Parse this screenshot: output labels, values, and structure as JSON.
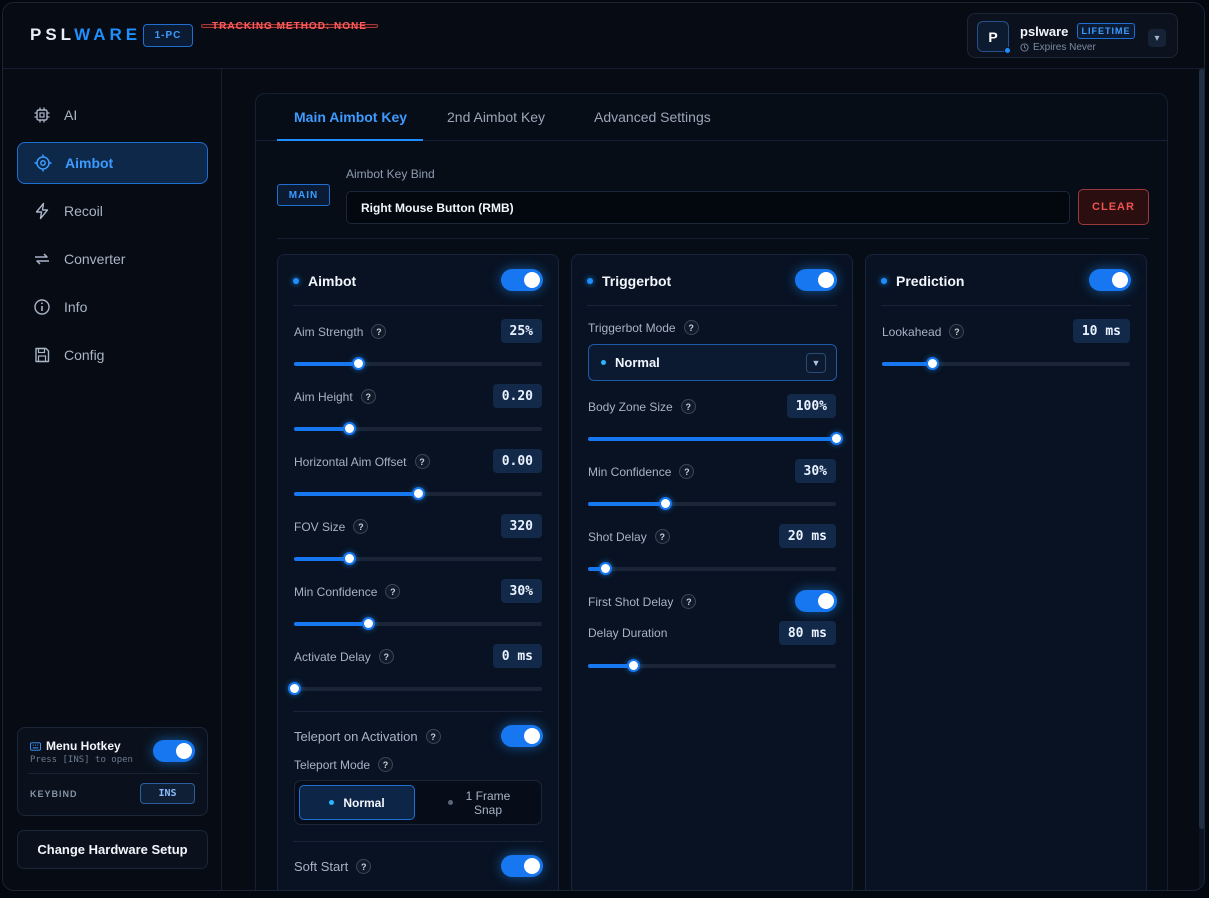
{
  "header": {
    "logo_left": "PSL",
    "logo_right": "WARE",
    "pc_badge": "1-PC",
    "tracking_badge": "TRACKING METHOD: NONE",
    "user": {
      "initial": "P",
      "name": "pslware",
      "plan": "LIFETIME",
      "expires": "Expires Never"
    }
  },
  "sidebar": {
    "items": [
      {
        "label": "AI",
        "icon": "chip-icon"
      },
      {
        "label": "Aimbot",
        "icon": "crosshair-icon",
        "active": true
      },
      {
        "label": "Recoil",
        "icon": "bolt-icon"
      },
      {
        "label": "Converter",
        "icon": "swap-icon"
      },
      {
        "label": "Info",
        "icon": "info-icon"
      },
      {
        "label": "Config",
        "icon": "save-icon"
      }
    ],
    "hotkey": {
      "title": "Menu Hotkey",
      "subtitle": "Press [INS] to open",
      "keybind_label": "KEYBIND",
      "key": "INS",
      "enabled": true
    },
    "hardware_button": "Change Hardware Setup"
  },
  "main": {
    "tabs": [
      "Main Aimbot Key",
      "2nd Aimbot Key",
      "Advanced Settings"
    ],
    "active_tab": 0,
    "main_badge": "MAIN",
    "keybind_label": "Aimbot Key Bind",
    "keybind_value": "Right Mouse Button (RMB)",
    "clear_button": "CLEAR"
  },
  "aimbot": {
    "title": "Aimbot",
    "enabled": true,
    "sliders": [
      {
        "label": "Aim Strength",
        "value": "25%",
        "fraction": 0.26
      },
      {
        "label": "Aim Height",
        "value": "0.20",
        "fraction": 0.22
      },
      {
        "label": "Horizontal Aim Offset",
        "value": "0.00",
        "fraction": 0.5
      },
      {
        "label": "FOV Size",
        "value": "320",
        "fraction": 0.22
      },
      {
        "label": "Min Confidence",
        "value": "30%",
        "fraction": 0.3
      },
      {
        "label": "Activate Delay",
        "value": "0 ms",
        "fraction": 0.0
      }
    ],
    "teleport_label": "Teleport on Activation",
    "teleport_enabled": true,
    "teleport_mode_label": "Teleport Mode",
    "teleport_modes": [
      "Normal",
      "1 Frame Snap"
    ],
    "teleport_mode_selected": 0,
    "soft_start_label": "Soft Start",
    "soft_start_enabled": true
  },
  "triggerbot": {
    "title": "Triggerbot",
    "enabled": true,
    "mode_label": "Triggerbot Mode",
    "mode_value": "Normal",
    "sliders": [
      {
        "label": "Body Zone Size",
        "value": "100%",
        "fraction": 1.0
      },
      {
        "label": "Min Confidence",
        "value": "30%",
        "fraction": 0.31
      },
      {
        "label": "Shot Delay",
        "value": "20 ms",
        "fraction": 0.07
      }
    ],
    "first_shot_label": "First Shot Delay",
    "first_shot_enabled": true,
    "delay_duration": {
      "label": "Delay Duration",
      "value": "80 ms",
      "fraction": 0.18
    }
  },
  "prediction": {
    "title": "Prediction",
    "enabled": true,
    "lookahead": {
      "label": "Lookahead",
      "value": "10 ms",
      "fraction": 0.2
    }
  },
  "colors": {
    "accent": "#1f8fff",
    "danger": "#f0524f",
    "background": "#060b14"
  }
}
